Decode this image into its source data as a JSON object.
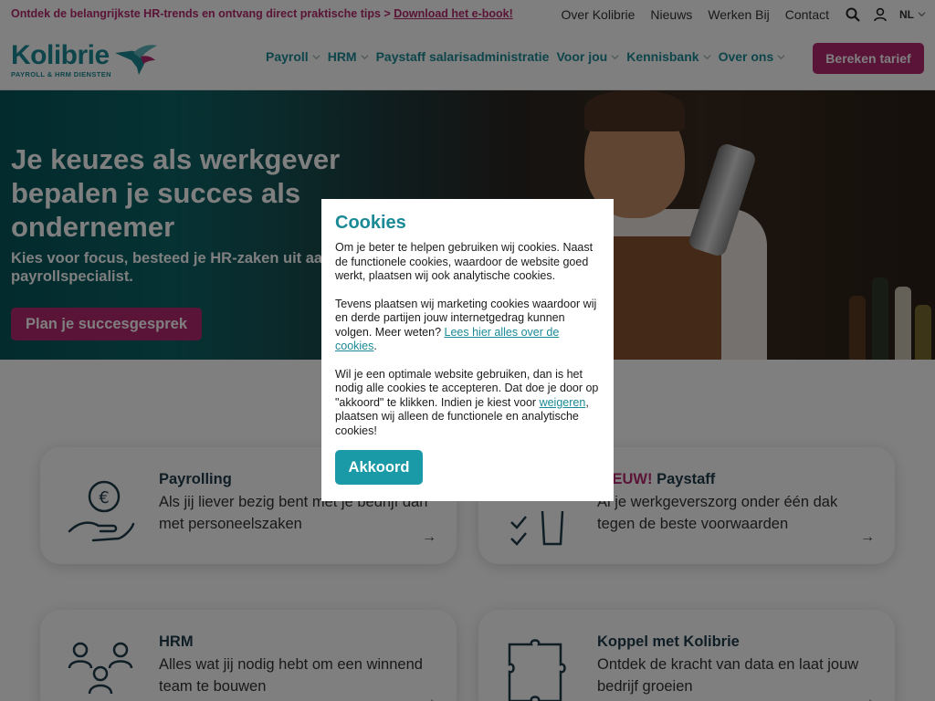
{
  "topbar": {
    "promo_text": "Ontdek de belangrijkste HR-trends en ontvang direct praktische tips >",
    "promo_link": "Download het e-book!",
    "links": [
      "Over Kolibrie",
      "Nieuws",
      "Werken Bij",
      "Contact"
    ],
    "language": "NL",
    "icons": [
      "search-icon",
      "user-icon",
      "chevron-down-icon"
    ]
  },
  "header": {
    "logo_word": "Kolibrie",
    "logo_sub": "PAYROLL & HRM DIENSTEN",
    "nav": [
      {
        "label": "Payroll",
        "dropdown": true
      },
      {
        "label": "HRM",
        "dropdown": true
      },
      {
        "label": "Paystaff salarisadministratie",
        "dropdown": false
      },
      {
        "label": "Voor jou",
        "dropdown": true
      },
      {
        "label": "Kennisbank",
        "dropdown": true
      },
      {
        "label": "Over ons",
        "dropdown": true
      }
    ],
    "cta": "Bereken tarief"
  },
  "hero": {
    "title": "Je keuzes als werkgever bepalen je succes als ondernemer",
    "subtitle": "Kies voor focus, besteed je HR-zaken uit aan je payrollspecialist.",
    "button": "Plan je succesgesprek"
  },
  "cards": [
    {
      "title": "Payrolling",
      "badge": "",
      "desc": "Als jij liever bezig bent met je bedrijf dan met personeelszaken",
      "icon": "euro-hand-icon"
    },
    {
      "title": "Paystaff",
      "badge": "NIEUW!",
      "desc": "Al je werkgeverszorg onder één dak tegen de beste voorwaarden",
      "icon": "checklist-icon"
    },
    {
      "title": "HRM",
      "badge": "",
      "desc": "Alles wat jij nodig hebt om een winnend team te bouwen",
      "icon": "people-icon"
    },
    {
      "title": "Koppel met Kolibrie",
      "badge": "",
      "desc": "Ontdek de kracht van data en laat jouw bedrijf groeien",
      "icon": "puzzle-icon"
    }
  ],
  "cookie_modal": {
    "title": "Cookies",
    "p1": "Om je beter te helpen gebruiken wij cookies. Naast de functionele cookies, waardoor de website goed werkt, plaatsen wij ook analytische cookies.",
    "p2_before": "Tevens plaatsen wij marketing cookies waardoor wij en derde partijen jouw internetgedrag kunnen volgen. Meer weten?",
    "p2_link": "Lees hier alles over de cookies",
    "p2_after": ".",
    "p3_before": "Wil je een optimale website gebruiken, dan is het nodig alle cookies te accepteren. Dat doe je door op \"akkoord\" te klikken. Indien je kiest voor",
    "p3_link": "weigeren",
    "p3_after": ", plaatsen wij alleen de functionele en analytische cookies!",
    "accept": "Akkoord"
  },
  "colors": {
    "brand_teal": "#1a8a96",
    "brand_magenta": "#b5286e",
    "overlay": "rgba(0,0,0,0.5)"
  }
}
